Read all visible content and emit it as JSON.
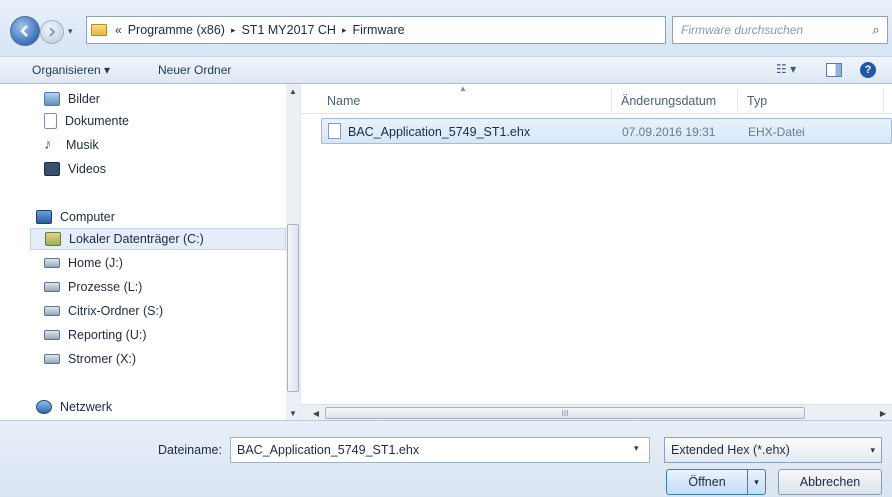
{
  "address_bar": {
    "overflow": "«",
    "breadcrumbs": [
      "Programme (x86)",
      "ST1 MY2017 CH",
      "Firmware"
    ],
    "separator": "▸",
    "refresh_glyph": "↻",
    "dropdown_glyph": "▾"
  },
  "search": {
    "placeholder": "Firmware durchsuchen",
    "icon_glyph": "⌕"
  },
  "toolbar": {
    "organize_label": "Organisieren ▾",
    "new_folder_label": "Neuer Ordner",
    "views_glyph": "☷ ▾",
    "help_glyph": "?"
  },
  "nav_pane": {
    "items": [
      {
        "label": "Bilder",
        "icon": "pictures-icon"
      },
      {
        "label": "Dokumente",
        "icon": "documents-icon"
      },
      {
        "label": "Musik",
        "icon": "music-icon"
      },
      {
        "label": "Videos",
        "icon": "videos-icon"
      },
      {
        "label": "Computer",
        "icon": "computer-icon"
      },
      {
        "label": "Lokaler Datenträger (C:)",
        "icon": "local-drive-icon"
      },
      {
        "label": "Home (J:)",
        "icon": "network-drive-icon"
      },
      {
        "label": "Prozesse (L:)",
        "icon": "network-drive-icon"
      },
      {
        "label": "Citrix-Ordner (S:)",
        "icon": "network-drive-icon"
      },
      {
        "label": "Reporting (U:)",
        "icon": "network-drive-icon"
      },
      {
        "label": "Stromer (X:)",
        "icon": "network-drive-icon"
      },
      {
        "label": "Netzwerk",
        "icon": "network-icon"
      }
    ],
    "music_glyph": "♪"
  },
  "file_list": {
    "columns": {
      "name": "Name",
      "date": "Änderungsdatum",
      "type": "Typ"
    },
    "sort_glyph": "▲",
    "rows": [
      {
        "name": "BAC_Application_5749_ST1.ehx",
        "date": "07.09.2016 19:31",
        "type": "EHX-Datei"
      }
    ],
    "scroll_glyphs": {
      "up": "▲",
      "down": "▼",
      "left": "◀",
      "right": "▶",
      "grip": "III"
    }
  },
  "bottom": {
    "filename_label": "Dateiname:",
    "filename_value": "BAC_Application_5749_ST1.ehx",
    "filetype_value": "Extended Hex (*.ehx)",
    "open_label": "Öffnen",
    "cancel_label": "Abbrechen",
    "dropdown_glyph": "▾"
  },
  "colors": {
    "window_bg": "#dfe9f5",
    "selection_bg": "#d6e6f8",
    "selection_border": "#9dbde3",
    "accent_blue": "#3e6fb6"
  }
}
